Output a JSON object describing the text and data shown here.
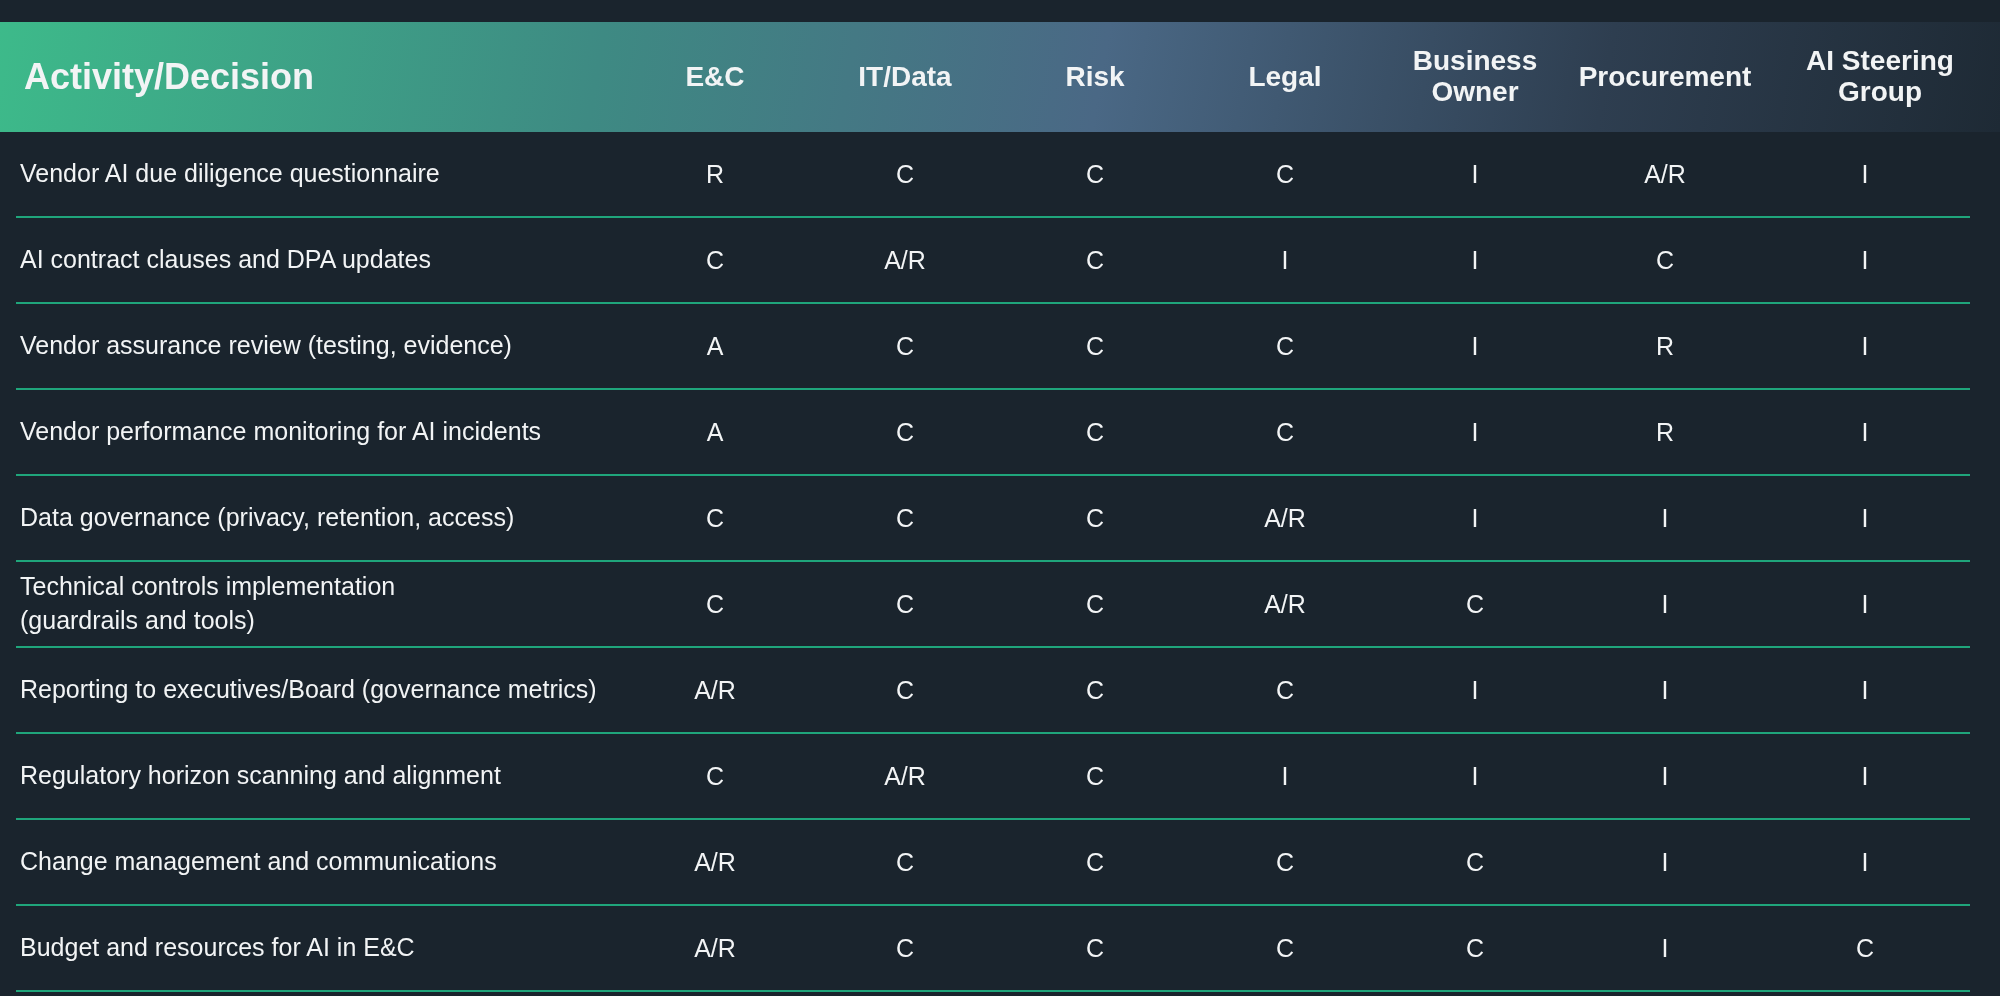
{
  "table": {
    "columns": [
      "Activity/Decision",
      "E&C",
      "IT/Data",
      "Risk",
      "Legal",
      "Business\nOwner",
      "Procurement",
      "AI Steering\nGroup"
    ],
    "rows": [
      {
        "cells": [
          "Vendor AI due diligence questionnaire",
          "R",
          "C",
          "C",
          "C",
          "I",
          "A/R",
          "I"
        ]
      },
      {
        "cells": [
          "AI contract clauses and DPA updates",
          "C",
          "A/R",
          "C",
          "I",
          "I",
          "C",
          "I"
        ]
      },
      {
        "cells": [
          "Vendor assurance review (testing, evidence)",
          "A",
          "C",
          "C",
          "C",
          "I",
          "R",
          "I"
        ]
      },
      {
        "cells": [
          "Vendor performance monitoring for AI incidents",
          "A",
          "C",
          "C",
          "C",
          "I",
          "R",
          "I"
        ]
      },
      {
        "cells": [
          "Data governance (privacy, retention, access)",
          "C",
          "C",
          "C",
          "A/R",
          "I",
          "I",
          "I"
        ]
      },
      {
        "cells": [
          "Technical controls implementation\n(guardrails and tools)",
          "C",
          "C",
          "C",
          "A/R",
          "C",
          "I",
          "I"
        ]
      },
      {
        "cells": [
          "Reporting to executives/Board (governance metrics)",
          "A/R",
          "C",
          "C",
          "C",
          "I",
          "I",
          "I"
        ]
      },
      {
        "cells": [
          "Regulatory horizon scanning and alignment",
          "C",
          "A/R",
          "C",
          "I",
          "I",
          "I",
          "I"
        ]
      },
      {
        "cells": [
          "Change management and communications",
          "A/R",
          "C",
          "C",
          "C",
          "C",
          "I",
          "I"
        ]
      },
      {
        "cells": [
          "Budget and resources for AI in E&C",
          "A/R",
          "C",
          "C",
          "C",
          "C",
          "I",
          "C"
        ]
      }
    ]
  }
}
